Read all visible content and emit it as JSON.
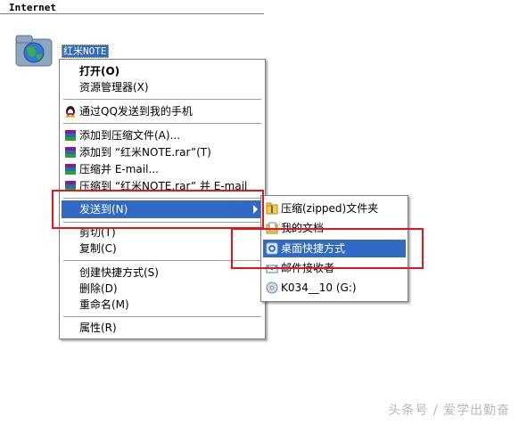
{
  "header": {
    "title": "Internet"
  },
  "desktop_icon": {
    "label": "红米NOTE",
    "icon": "globe-folder-icon"
  },
  "context_menu": {
    "items": [
      {
        "label": "打开(O)",
        "bold": true
      },
      {
        "label": "资源管理器(X)"
      },
      {
        "label": "通过QQ发送到我的手机",
        "icon": "qq-penguin-icon"
      },
      {
        "label": "添加到压缩文件(A)...",
        "icon": "winrar-icon"
      },
      {
        "label": "添加到 “红米NOTE.rar”(T)",
        "icon": "winrar-icon"
      },
      {
        "label": "压缩并 E-mail...",
        "icon": "winrar-icon"
      },
      {
        "label": "压缩到 “红米NOTE.rar” 并 E-mail",
        "icon": "winrar-icon"
      },
      {
        "label": "发送到(N)",
        "highlighted": true,
        "has_submenu": true
      },
      {
        "label": "剪切(T)"
      },
      {
        "label": "复制(C)"
      },
      {
        "label": "创建快捷方式(S)"
      },
      {
        "label": "删除(D)"
      },
      {
        "label": "重命名(M)"
      },
      {
        "label": "属性(R)"
      }
    ]
  },
  "send_to_menu": {
    "items": [
      {
        "label": "压缩(zipped)文件夹",
        "icon": "zip-folder-icon"
      },
      {
        "label": "我的文档",
        "icon": "my-documents-icon"
      },
      {
        "label": "桌面快捷方式",
        "icon": "desktop-shortcut-icon",
        "highlighted": true
      },
      {
        "label": "邮件接收者",
        "icon": "mail-recipient-icon"
      },
      {
        "label": "K034__10 (G:)",
        "icon": "cd-drive-icon"
      }
    ]
  },
  "colors": {
    "highlight": "#316ac5",
    "annotation": "#e3161e"
  },
  "watermark": "头条号 / 爱学出勤奋"
}
